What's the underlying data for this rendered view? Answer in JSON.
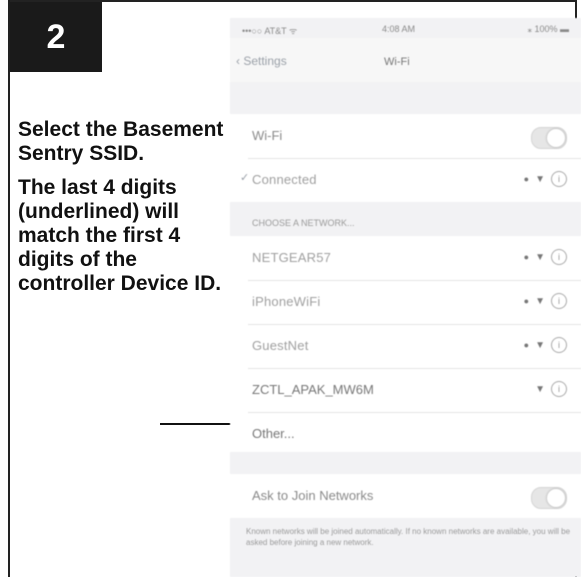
{
  "step": {
    "number": "2"
  },
  "instructions": {
    "line1": "Select the Basement Sentry SSID.",
    "line2": "The last 4 digits (underlined) will match the first 4 digits of the controller Device ID."
  },
  "phone": {
    "status": {
      "carrier": "•••○○ AT&T ᯤ",
      "time": "4:08 AM",
      "battery": "⁎ 100% ▬"
    },
    "nav": {
      "back": "‹ Settings",
      "title": "Wi-Fi"
    },
    "wifi_row": {
      "label": "Wi-Fi"
    },
    "connected_network": {
      "name": "Connected"
    },
    "section_header": "CHOOSE A NETWORK...",
    "networks": [
      {
        "name": "NETGEAR57"
      },
      {
        "name": "iPhoneWiFi"
      },
      {
        "name": "GuestNet"
      },
      {
        "name": "ZCTL_APAK_MW6M"
      },
      {
        "name": "Other..."
      }
    ],
    "ask_row": {
      "label": "Ask to Join Networks"
    },
    "footer": "Known networks will be joined automatically. If no known networks are available, you will be asked before joining a new network."
  },
  "colors": {
    "badge": "#1a1a1a",
    "text": "#111111",
    "phone_bg": "#f2f2f4"
  }
}
